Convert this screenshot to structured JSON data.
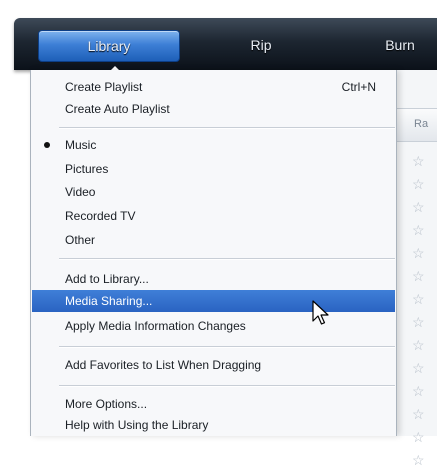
{
  "toolbar": {
    "tabs": [
      {
        "label": "Library"
      },
      {
        "label": "Rip"
      },
      {
        "label": "Burn"
      }
    ]
  },
  "background": {
    "column_header": "Ra",
    "rating_icon": "star-outline-icon"
  },
  "menu": {
    "items": {
      "create_playlist": {
        "label": "Create Playlist",
        "shortcut": "Ctrl+N"
      },
      "create_auto_playlist": {
        "label": "Create Auto Playlist"
      },
      "music": {
        "label": "Music",
        "checked": true
      },
      "pictures": {
        "label": "Pictures"
      },
      "video": {
        "label": "Video"
      },
      "recorded_tv": {
        "label": "Recorded TV"
      },
      "other": {
        "label": "Other"
      },
      "add_to_library": {
        "label": "Add to Library..."
      },
      "media_sharing": {
        "label": "Media Sharing...",
        "highlighted": true
      },
      "apply_media_info": {
        "label": "Apply Media Information Changes"
      },
      "add_favorites": {
        "label": "Add Favorites to List When Dragging"
      },
      "more_options": {
        "label": "More Options..."
      },
      "help": {
        "label": "Help with Using the Library"
      }
    }
  },
  "colors": {
    "toolbar_dark": "#1d2631",
    "library_tab_blue": "#3d7fd6",
    "highlight_blue": "#2a63c2",
    "menu_bg": "#f7f8fa"
  }
}
